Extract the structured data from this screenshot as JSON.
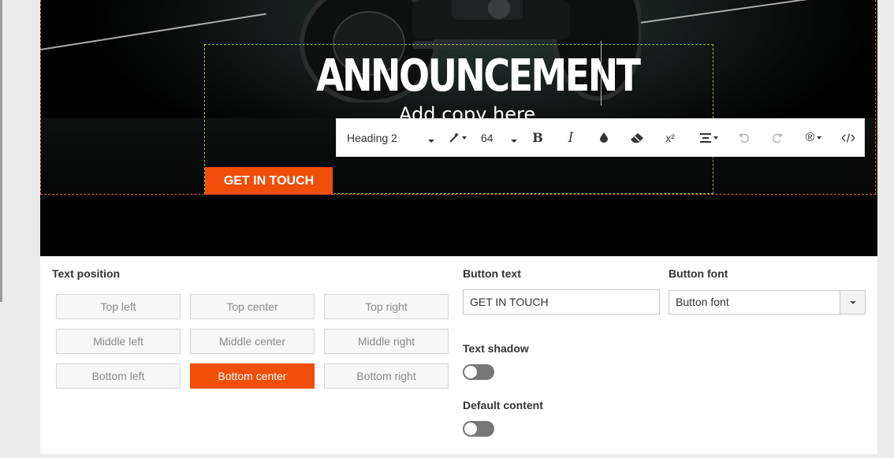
{
  "hero": {
    "headline": "ANNOUNCEMENT",
    "subcopy": "Add copy here",
    "cta_label": "GET IN TOUCH"
  },
  "toolbar": {
    "heading_select": "Heading 2",
    "font_size": "64",
    "icons": [
      "magic-wand-icon",
      "bold-icon",
      "italic-icon",
      "text-color-icon",
      "eraser-icon",
      "superscript-icon",
      "align-center-icon",
      "undo-icon",
      "redo-icon",
      "special-characters-icon",
      "source-code-icon"
    ]
  },
  "settings": {
    "text_position_label": "Text position",
    "positions": [
      {
        "label": "Top left"
      },
      {
        "label": "Top center"
      },
      {
        "label": "Top right"
      },
      {
        "label": "Middle left"
      },
      {
        "label": "Middle center"
      },
      {
        "label": "Middle right"
      },
      {
        "label": "Bottom left"
      },
      {
        "label": "Bottom center"
      },
      {
        "label": "Bottom right"
      }
    ],
    "active_position": "Bottom center",
    "button_text_label": "Button text",
    "button_text_value": "GET IN TOUCH",
    "button_font_label": "Button font",
    "button_font_value": "Button font",
    "text_shadow_label": "Text shadow",
    "text_shadow_on": false,
    "default_content_label": "Default content",
    "default_content_on": false
  },
  "colors": {
    "accent": "#f04e0a",
    "guide_red": "#d16b3e",
    "guide_green": "#8bbd3a"
  }
}
